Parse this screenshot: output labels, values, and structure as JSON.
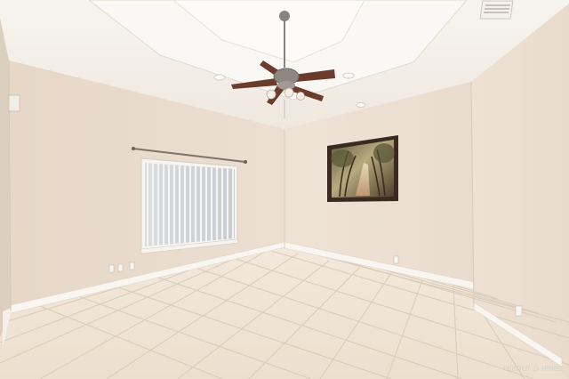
{
  "photo": {
    "subject": "empty room with ceiling fan, window with vertical blinds, framed tree-lined path artwork, and tiled floor",
    "watermark": "GREATER LA HOMES"
  },
  "colors": {
    "wall_left": "#e7d9ca",
    "wall_back": "#ecdfd1",
    "wall_right": "#eee2d5",
    "ceiling": "#f6f2ec",
    "floor": "#efe2d3",
    "grout": "#d6c7b6",
    "baseboard": "#f8f5f0",
    "fan_wood": "#6b3b2b",
    "fan_metal": "#8a8480",
    "frame": "#3a2a22"
  }
}
